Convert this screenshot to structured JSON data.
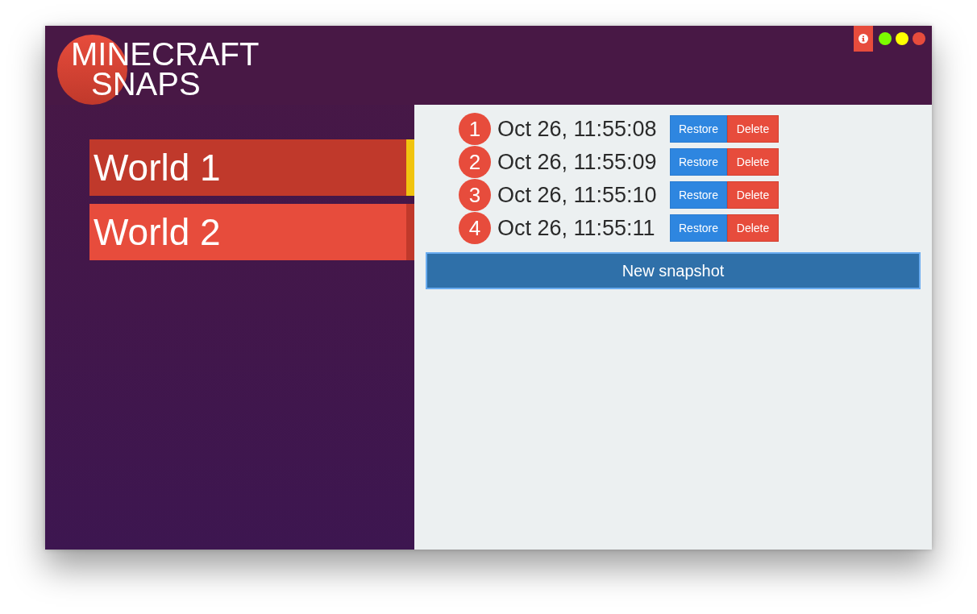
{
  "logo": {
    "lines": [
      "MINECRAFT",
      "SNAPS"
    ]
  },
  "window_controls": [
    {
      "color": "#7cfc00"
    },
    {
      "color": "#ffff00"
    },
    {
      "color": "#e74c3c"
    }
  ],
  "worlds": [
    {
      "name": "World 1",
      "selected": true
    },
    {
      "name": "World 2",
      "selected": false
    }
  ],
  "snapshots": [
    {
      "number": "1",
      "time": "Oct 26, 11:55:08",
      "actions": [
        {
          "kind": "restore",
          "label": "Restore"
        },
        {
          "kind": "delete",
          "label": "Delete"
        }
      ]
    },
    {
      "number": "2",
      "time": "Oct 26, 11:55:09",
      "actions": [
        {
          "kind": "restore",
          "label": "Restore"
        },
        {
          "kind": "delete",
          "label": "Delete"
        }
      ]
    },
    {
      "number": "3",
      "time": "Oct 26, 11:55:10",
      "actions": [
        {
          "kind": "restore",
          "label": "Restore"
        },
        {
          "kind": "delete",
          "label": "Delete"
        }
      ]
    },
    {
      "number": "4",
      "time": "Oct 26, 11:55:11",
      "actions": [
        {
          "kind": "restore",
          "label": "Restore"
        },
        {
          "kind": "delete",
          "label": "Delete"
        }
      ]
    }
  ],
  "new_snapshot_button": {
    "label": "New snapshot"
  }
}
